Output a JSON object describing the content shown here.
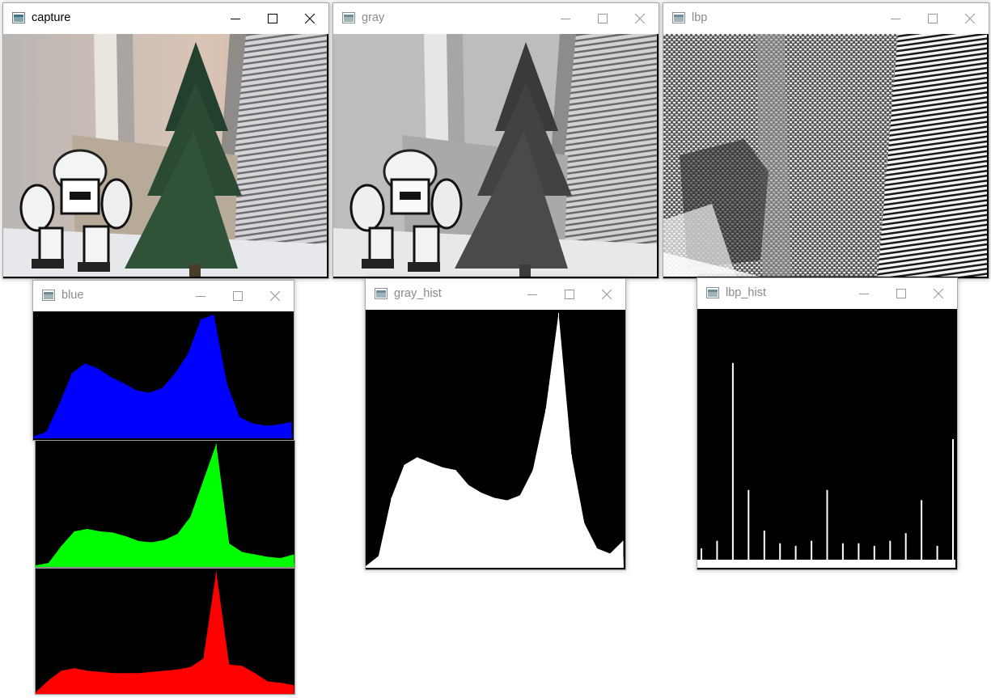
{
  "windows": {
    "capture": {
      "title": "capture"
    },
    "gray": {
      "title": "gray"
    },
    "lbp": {
      "title": "lbp"
    },
    "blue": {
      "title": "blue"
    },
    "gray_hist": {
      "title": "gray_hist"
    },
    "lbp_hist": {
      "title": "lbp_hist"
    }
  },
  "icons": {
    "app": "opencv-window-icon",
    "minimize": "minimize-icon",
    "maximize": "maximize-icon",
    "close": "close-icon"
  },
  "colors": {
    "blue_channel": "#0000ff",
    "green_channel": "#00ff00",
    "red_channel": "#ff0000",
    "gray_hist": "#ffffff",
    "lbp_hist": "#ffffff",
    "background": "#000000"
  },
  "chart_data": [
    {
      "name": "blue",
      "type": "area",
      "x": [
        0,
        5,
        10,
        15,
        20,
        25,
        30,
        35,
        40,
        45,
        50,
        55,
        60,
        65,
        70,
        75,
        80,
        85,
        90,
        95,
        100
      ],
      "y": [
        0,
        4,
        26,
        52,
        60,
        56,
        49,
        44,
        38,
        36,
        40,
        52,
        68,
        96,
        100,
        44,
        16,
        11,
        9,
        10,
        12
      ],
      "ylim": [
        0,
        100
      ]
    },
    {
      "name": "green",
      "type": "area",
      "x": [
        0,
        5,
        10,
        15,
        20,
        25,
        30,
        35,
        40,
        45,
        50,
        55,
        60,
        65,
        70,
        75,
        80,
        85,
        90,
        95,
        100
      ],
      "y": [
        0,
        2,
        16,
        28,
        30,
        28,
        27,
        24,
        20,
        19,
        21,
        26,
        40,
        70,
        100,
        18,
        11,
        9,
        7,
        6,
        9
      ],
      "ylim": [
        0,
        100
      ]
    },
    {
      "name": "red",
      "type": "area",
      "x": [
        0,
        5,
        10,
        15,
        20,
        25,
        30,
        35,
        40,
        45,
        50,
        55,
        60,
        65,
        70,
        75,
        80,
        85,
        90,
        95,
        100
      ],
      "y": [
        0,
        10,
        18,
        20,
        18,
        17,
        16,
        16,
        16,
        17,
        18,
        19,
        21,
        28,
        100,
        23,
        22,
        16,
        9,
        8,
        6
      ],
      "ylim": [
        0,
        100
      ]
    },
    {
      "name": "gray_hist",
      "type": "area",
      "x": [
        0,
        5,
        10,
        15,
        20,
        25,
        30,
        35,
        40,
        45,
        50,
        55,
        60,
        65,
        70,
        75,
        80,
        85,
        90,
        95,
        100
      ],
      "y": [
        0,
        4,
        27,
        40,
        43,
        41,
        39,
        38,
        32,
        29,
        27,
        26,
        28,
        38,
        62,
        100,
        44,
        17,
        7,
        5,
        10
      ],
      "ylim": [
        0,
        100
      ]
    },
    {
      "name": "lbp_hist",
      "type": "bar",
      "categories": [
        "0",
        "4",
        "8",
        "12",
        "16",
        "20",
        "24",
        "28",
        "32",
        "36",
        "40",
        "44",
        "48",
        "52",
        "56",
        "60",
        "64"
      ],
      "values": [
        7,
        10,
        80,
        30,
        14,
        9,
        8,
        10,
        30,
        9,
        9,
        8,
        10,
        13,
        26,
        8,
        50
      ],
      "ylim": [
        0,
        100
      ]
    }
  ]
}
